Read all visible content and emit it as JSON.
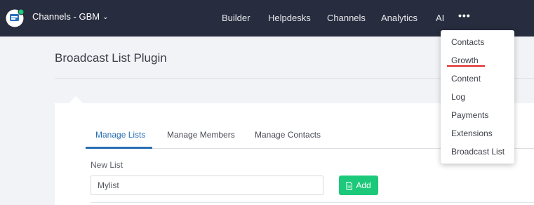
{
  "topbar": {
    "channel": "Channels - GBM",
    "nav": [
      "Builder",
      "Helpdesks",
      "Channels",
      "Analytics",
      "AI"
    ],
    "more": "•••",
    "status_color": "#1cc97a"
  },
  "page": {
    "title": "Broadcast List Plugin"
  },
  "tabs": [
    {
      "label": "Manage Lists",
      "active": true
    },
    {
      "label": "Manage Members",
      "active": false
    },
    {
      "label": "Manage Contacts",
      "active": false
    }
  ],
  "form": {
    "label": "New List",
    "value": "Mylist",
    "add_label": "Add",
    "add_color": "#1cc97a"
  },
  "dropdown": {
    "items": [
      "Contacts",
      "Growth",
      "Content",
      "Log",
      "Payments",
      "Extensions",
      "Broadcast List"
    ],
    "highlighted": "Growth",
    "highlight_color": "#e0262a"
  },
  "icons": {
    "logo": "chat-bot-logo-icon",
    "chevron": "chevron-down-icon",
    "add": "document-icon"
  }
}
